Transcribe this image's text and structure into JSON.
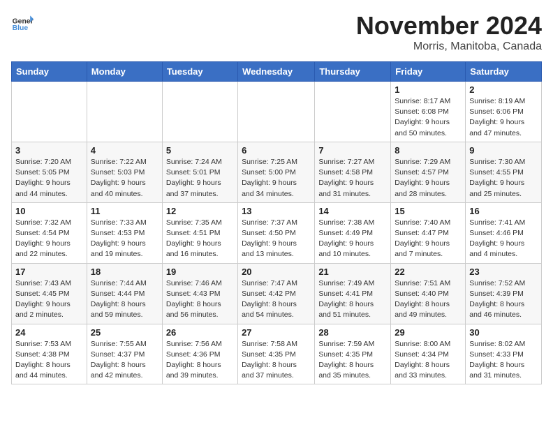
{
  "logo": {
    "line1": "General",
    "line2": "Blue"
  },
  "title": "November 2024",
  "location": "Morris, Manitoba, Canada",
  "days_of_week": [
    "Sunday",
    "Monday",
    "Tuesday",
    "Wednesday",
    "Thursday",
    "Friday",
    "Saturday"
  ],
  "weeks": [
    [
      {
        "day": "",
        "info": ""
      },
      {
        "day": "",
        "info": ""
      },
      {
        "day": "",
        "info": ""
      },
      {
        "day": "",
        "info": ""
      },
      {
        "day": "",
        "info": ""
      },
      {
        "day": "1",
        "info": "Sunrise: 8:17 AM\nSunset: 6:08 PM\nDaylight: 9 hours\nand 50 minutes."
      },
      {
        "day": "2",
        "info": "Sunrise: 8:19 AM\nSunset: 6:06 PM\nDaylight: 9 hours\nand 47 minutes."
      }
    ],
    [
      {
        "day": "3",
        "info": "Sunrise: 7:20 AM\nSunset: 5:05 PM\nDaylight: 9 hours\nand 44 minutes."
      },
      {
        "day": "4",
        "info": "Sunrise: 7:22 AM\nSunset: 5:03 PM\nDaylight: 9 hours\nand 40 minutes."
      },
      {
        "day": "5",
        "info": "Sunrise: 7:24 AM\nSunset: 5:01 PM\nDaylight: 9 hours\nand 37 minutes."
      },
      {
        "day": "6",
        "info": "Sunrise: 7:25 AM\nSunset: 5:00 PM\nDaylight: 9 hours\nand 34 minutes."
      },
      {
        "day": "7",
        "info": "Sunrise: 7:27 AM\nSunset: 4:58 PM\nDaylight: 9 hours\nand 31 minutes."
      },
      {
        "day": "8",
        "info": "Sunrise: 7:29 AM\nSunset: 4:57 PM\nDaylight: 9 hours\nand 28 minutes."
      },
      {
        "day": "9",
        "info": "Sunrise: 7:30 AM\nSunset: 4:55 PM\nDaylight: 9 hours\nand 25 minutes."
      }
    ],
    [
      {
        "day": "10",
        "info": "Sunrise: 7:32 AM\nSunset: 4:54 PM\nDaylight: 9 hours\nand 22 minutes."
      },
      {
        "day": "11",
        "info": "Sunrise: 7:33 AM\nSunset: 4:53 PM\nDaylight: 9 hours\nand 19 minutes."
      },
      {
        "day": "12",
        "info": "Sunrise: 7:35 AM\nSunset: 4:51 PM\nDaylight: 9 hours\nand 16 minutes."
      },
      {
        "day": "13",
        "info": "Sunrise: 7:37 AM\nSunset: 4:50 PM\nDaylight: 9 hours\nand 13 minutes."
      },
      {
        "day": "14",
        "info": "Sunrise: 7:38 AM\nSunset: 4:49 PM\nDaylight: 9 hours\nand 10 minutes."
      },
      {
        "day": "15",
        "info": "Sunrise: 7:40 AM\nSunset: 4:47 PM\nDaylight: 9 hours\nand 7 minutes."
      },
      {
        "day": "16",
        "info": "Sunrise: 7:41 AM\nSunset: 4:46 PM\nDaylight: 9 hours\nand 4 minutes."
      }
    ],
    [
      {
        "day": "17",
        "info": "Sunrise: 7:43 AM\nSunset: 4:45 PM\nDaylight: 9 hours\nand 2 minutes."
      },
      {
        "day": "18",
        "info": "Sunrise: 7:44 AM\nSunset: 4:44 PM\nDaylight: 8 hours\nand 59 minutes."
      },
      {
        "day": "19",
        "info": "Sunrise: 7:46 AM\nSunset: 4:43 PM\nDaylight: 8 hours\nand 56 minutes."
      },
      {
        "day": "20",
        "info": "Sunrise: 7:47 AM\nSunset: 4:42 PM\nDaylight: 8 hours\nand 54 minutes."
      },
      {
        "day": "21",
        "info": "Sunrise: 7:49 AM\nSunset: 4:41 PM\nDaylight: 8 hours\nand 51 minutes."
      },
      {
        "day": "22",
        "info": "Sunrise: 7:51 AM\nSunset: 4:40 PM\nDaylight: 8 hours\nand 49 minutes."
      },
      {
        "day": "23",
        "info": "Sunrise: 7:52 AM\nSunset: 4:39 PM\nDaylight: 8 hours\nand 46 minutes."
      }
    ],
    [
      {
        "day": "24",
        "info": "Sunrise: 7:53 AM\nSunset: 4:38 PM\nDaylight: 8 hours\nand 44 minutes."
      },
      {
        "day": "25",
        "info": "Sunrise: 7:55 AM\nSunset: 4:37 PM\nDaylight: 8 hours\nand 42 minutes."
      },
      {
        "day": "26",
        "info": "Sunrise: 7:56 AM\nSunset: 4:36 PM\nDaylight: 8 hours\nand 39 minutes."
      },
      {
        "day": "27",
        "info": "Sunrise: 7:58 AM\nSunset: 4:35 PM\nDaylight: 8 hours\nand 37 minutes."
      },
      {
        "day": "28",
        "info": "Sunrise: 7:59 AM\nSunset: 4:35 PM\nDaylight: 8 hours\nand 35 minutes."
      },
      {
        "day": "29",
        "info": "Sunrise: 8:00 AM\nSunset: 4:34 PM\nDaylight: 8 hours\nand 33 minutes."
      },
      {
        "day": "30",
        "info": "Sunrise: 8:02 AM\nSunset: 4:33 PM\nDaylight: 8 hours\nand 31 minutes."
      }
    ]
  ]
}
